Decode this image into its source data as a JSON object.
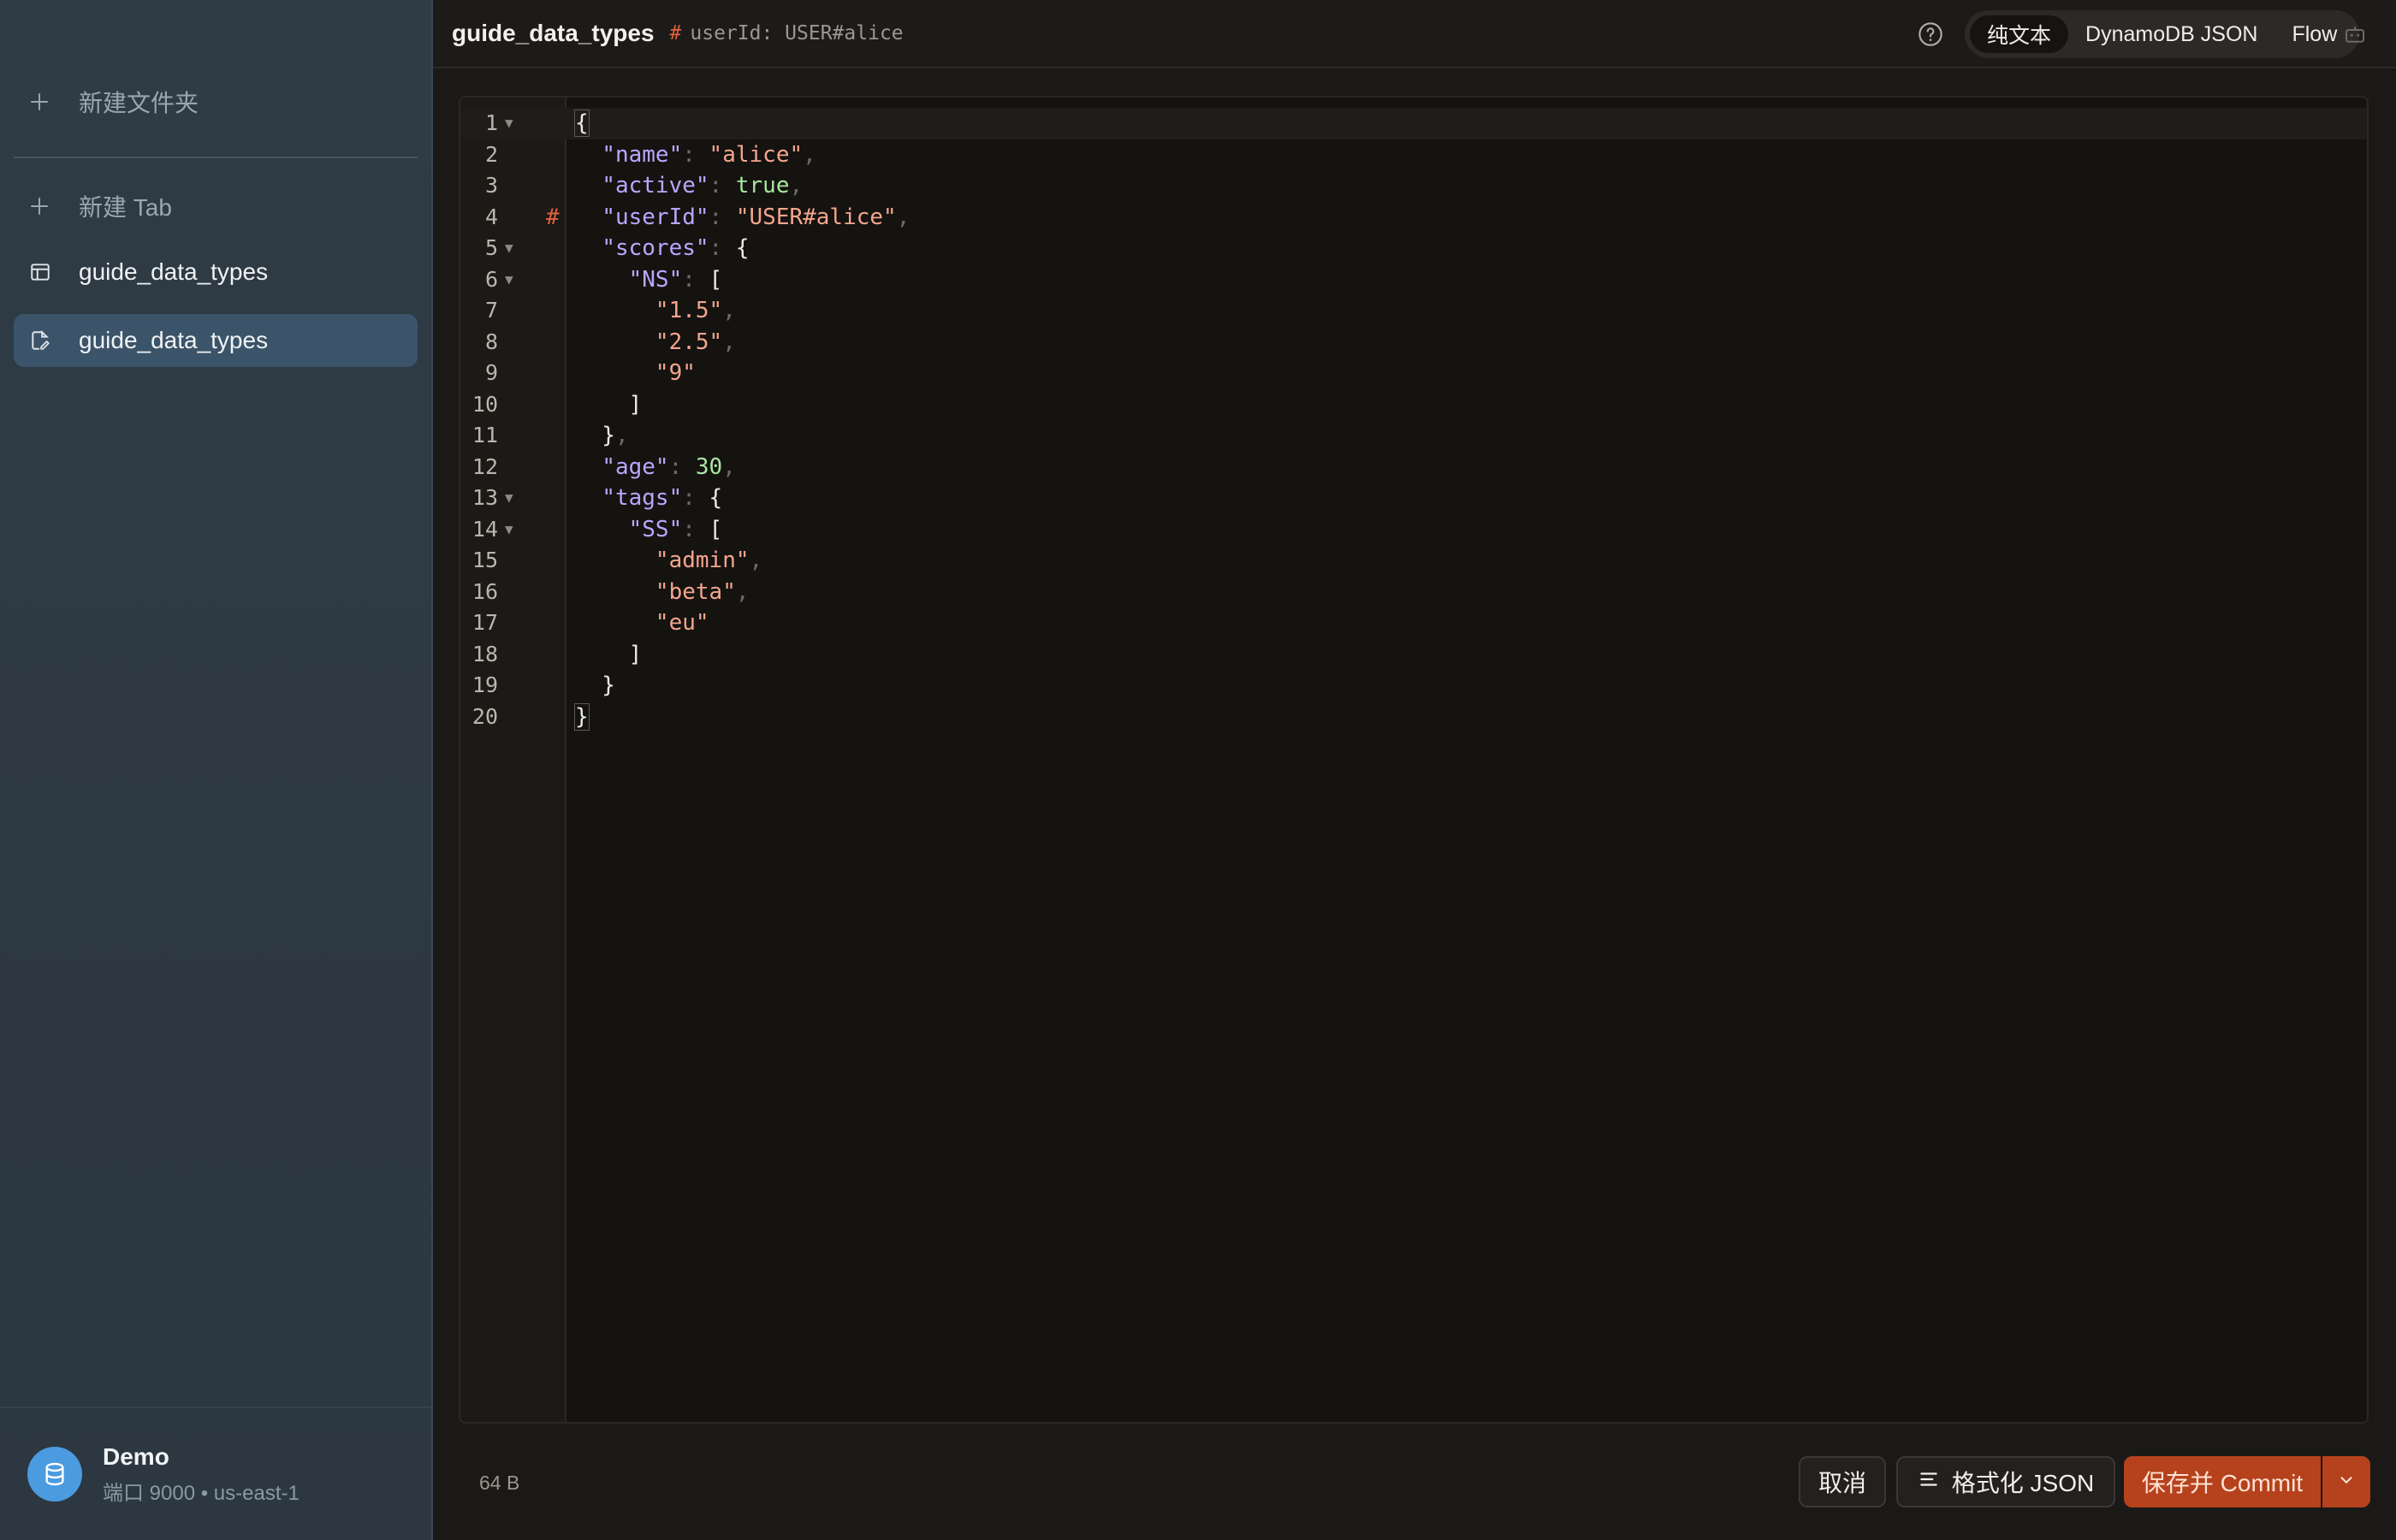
{
  "sidebar": {
    "new_folder": "新建文件夹",
    "new_tab": "新建 Tab",
    "items": [
      {
        "label": "guide_data_types",
        "icon": "table-icon"
      },
      {
        "label": "guide_data_types",
        "icon": "document-edit-icon",
        "active": true
      }
    ],
    "connection": {
      "name": "Demo",
      "detail": "端口 9000 • us-east-1",
      "icon": "database-icon"
    }
  },
  "header": {
    "title": "guide_data_types",
    "key_hash": "#",
    "key_text": "userId: USER#alice",
    "modes": [
      "纯文本",
      "DynamoDB JSON",
      "Flow"
    ],
    "active_mode": "纯文本"
  },
  "editor": {
    "lines": [
      {
        "n": "1",
        "fold": true
      },
      {
        "n": "2"
      },
      {
        "n": "3"
      },
      {
        "n": "4",
        "mark": "#"
      },
      {
        "n": "5",
        "fold": true
      },
      {
        "n": "6",
        "fold": true
      },
      {
        "n": "7"
      },
      {
        "n": "8"
      },
      {
        "n": "9"
      },
      {
        "n": "10"
      },
      {
        "n": "11"
      },
      {
        "n": "12"
      },
      {
        "n": "13",
        "fold": true
      },
      {
        "n": "14",
        "fold": true
      },
      {
        "n": "15"
      },
      {
        "n": "16"
      },
      {
        "n": "17"
      },
      {
        "n": "18"
      },
      {
        "n": "19"
      },
      {
        "n": "20"
      }
    ],
    "tokens": {
      "name_key": "\"name\"",
      "name_val": "\"alice\"",
      "active_key": "\"active\"",
      "active_val": "true",
      "userid_key": "\"userId\"",
      "userid_val": "\"USER#alice\"",
      "scores_key": "\"scores\"",
      "ns_key": "\"NS\"",
      "ns_1": "\"1.5\"",
      "ns_2": "\"2.5\"",
      "ns_3": "\"9\"",
      "age_key": "\"age\"",
      "age_val": "30",
      "tags_key": "\"tags\"",
      "ss_key": "\"SS\"",
      "ss_1": "\"admin\"",
      "ss_2": "\"beta\"",
      "ss_3": "\"eu\""
    }
  },
  "footer": {
    "size": "64 B",
    "cancel": "取消",
    "format": "格式化 JSON",
    "save": "保存并 Commit"
  }
}
